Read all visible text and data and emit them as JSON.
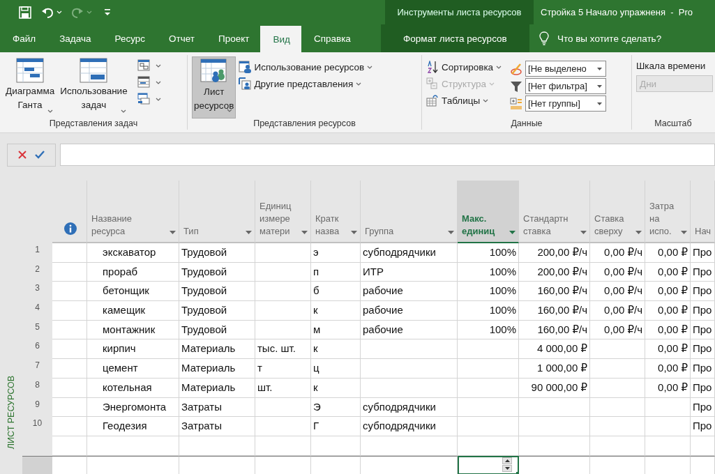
{
  "quick_access": [
    {
      "kind": "save",
      "disabled": false,
      "dropdown": false
    },
    {
      "kind": "undo",
      "disabled": false,
      "dropdown": true
    },
    {
      "kind": "redo",
      "disabled": true,
      "dropdown": true
    },
    {
      "kind": "customize",
      "disabled": false,
      "dropdown": false
    }
  ],
  "title_bar": {
    "context_group": "Инструменты листа ресурсов",
    "title": "Стройка 5 Начало упражненя  -  Pro"
  },
  "tabs": [
    {
      "label": "Файл",
      "selected": false,
      "kind": "main"
    },
    {
      "label": "Задача",
      "selected": false,
      "kind": "main"
    },
    {
      "label": "Ресурс",
      "selected": false,
      "kind": "main"
    },
    {
      "label": "Отчет",
      "selected": false,
      "kind": "main"
    },
    {
      "label": "Проект",
      "selected": false,
      "kind": "main"
    },
    {
      "label": "Вид",
      "selected": true,
      "kind": "main"
    },
    {
      "label": "Справка",
      "selected": false,
      "kind": "main"
    },
    {
      "label": "Формат листа ресурсов",
      "selected": false,
      "kind": "contextual"
    }
  ],
  "tell_me": "Что вы хотите сделать?",
  "ribbon": [
    {
      "label": "Представления задач",
      "items": [
        {
          "kind": "large",
          "label": "Диаграмма\nГанта",
          "dropdown": true,
          "selected": false
        },
        {
          "kind": "large",
          "label": "Использование\nзадач",
          "dropdown": true,
          "selected": false
        },
        {
          "kind": "iconstack",
          "buttons": [
            {
              "dropdown": true
            },
            {
              "dropdown": true
            },
            {
              "dropdown": true
            }
          ]
        }
      ]
    },
    {
      "label": "Представления ресурсов",
      "items": [
        {
          "kind": "large",
          "label": "Лист\nресурсов",
          "dropdown": true,
          "selected": true
        },
        {
          "kind": "stack",
          "buttons": [
            {
              "label": "Использование ресурсов",
              "dropdown": true,
              "disabled": false
            },
            {
              "label": "Другие представления",
              "dropdown": true,
              "disabled": false
            }
          ]
        }
      ]
    },
    {
      "label": "Данные",
      "items": [
        {
          "kind": "stack",
          "buttons": [
            {
              "label": "Сортировка",
              "dropdown": true,
              "disabled": false
            },
            {
              "label": "Структура",
              "dropdown": true,
              "disabled": true
            },
            {
              "label": "Таблицы",
              "dropdown": true,
              "disabled": false
            }
          ]
        },
        {
          "kind": "combos",
          "combos": [
            {
              "value": "[Не выделено",
              "disabled": false
            },
            {
              "value": "[Нет фильтра]",
              "disabled": false
            },
            {
              "value": "[Нет группы]",
              "disabled": false
            }
          ]
        }
      ]
    },
    {
      "label": "Масштаб",
      "items": [
        {
          "kind": "labeled_combo",
          "label": "Шкала времени",
          "value": "Дни",
          "disabled": true
        }
      ]
    }
  ],
  "view_bar": "ЛИСТ РЕСУРСОВ",
  "table": {
    "columns": [
      {
        "kind": "icon",
        "selected": false
      },
      {
        "kind": "text",
        "label": "Название\nресурса",
        "selected": false
      },
      {
        "kind": "text",
        "label": "Тип",
        "selected": false
      },
      {
        "kind": "text",
        "label": "Единиц\nизмере\nматери",
        "selected": false
      },
      {
        "kind": "text",
        "label": "Кратк\nназва",
        "selected": false
      },
      {
        "kind": "text",
        "label": "Группа",
        "selected": false
      },
      {
        "kind": "number",
        "label": "Макс.\nединиц",
        "selected": true
      },
      {
        "kind": "number",
        "label": "Стандартн\nставка",
        "selected": false
      },
      {
        "kind": "number",
        "label": "Ставка\nсверху",
        "selected": false
      },
      {
        "kind": "number",
        "label": "Затра\nна\nиспо.",
        "selected": false
      },
      {
        "kind": "text",
        "label": "Нач",
        "selected": false
      }
    ],
    "rows": [
      {
        "number": "1",
        "cells": [
          "",
          "экскаватор",
          "Трудовой",
          "",
          "э",
          "субподрядчики",
          "100%",
          "200,00 ₽/ч",
          "0,00 ₽/ч",
          "0,00 ₽",
          "Про"
        ]
      },
      {
        "number": "2",
        "cells": [
          "",
          "прораб",
          "Трудовой",
          "",
          "п",
          "ИТР",
          "100%",
          "200,00 ₽/ч",
          "0,00 ₽/ч",
          "0,00 ₽",
          "Про"
        ]
      },
      {
        "number": "3",
        "cells": [
          "",
          "бетонщик",
          "Трудовой",
          "",
          "б",
          "рабочие",
          "100%",
          "160,00 ₽/ч",
          "0,00 ₽/ч",
          "0,00 ₽",
          "Про"
        ]
      },
      {
        "number": "4",
        "cells": [
          "",
          "камещик",
          "Трудовой",
          "",
          "к",
          "рабочие",
          "100%",
          "160,00 ₽/ч",
          "0,00 ₽/ч",
          "0,00 ₽",
          "Про"
        ]
      },
      {
        "number": "5",
        "cells": [
          "",
          "монтажник",
          "Трудовой",
          "",
          "м",
          "рабочие",
          "100%",
          "160,00 ₽/ч",
          "0,00 ₽/ч",
          "0,00 ₽",
          "Про"
        ]
      },
      {
        "number": "6",
        "cells": [
          "",
          "кирпич",
          "Материаль",
          "тыс. шт.",
          "к",
          "",
          "",
          "4 000,00 ₽",
          "",
          "0,00 ₽",
          "Про"
        ]
      },
      {
        "number": "7",
        "cells": [
          "",
          "цемент",
          "Материаль",
          "т",
          "ц",
          "",
          "",
          "1 000,00 ₽",
          "",
          "0,00 ₽",
          "Про"
        ]
      },
      {
        "number": "8",
        "cells": [
          "",
          "котельная",
          "Материаль",
          "шт.",
          "к",
          "",
          "",
          "90 000,00 ₽",
          "",
          "0,00 ₽",
          "Про"
        ]
      },
      {
        "number": "9",
        "cells": [
          "",
          "Энергомонта",
          "Затраты",
          "",
          "Э",
          "субподрядчики",
          "",
          "",
          "",
          "",
          "Про"
        ]
      },
      {
        "number": "10",
        "cells": [
          "",
          "Геодезия",
          "Затраты",
          "",
          "Г",
          "субподрядчики",
          "",
          "",
          "",
          "",
          "Про"
        ]
      }
    ],
    "new_rows": [
      {
        "selected": false
      },
      {
        "selected": true
      }
    ]
  }
}
